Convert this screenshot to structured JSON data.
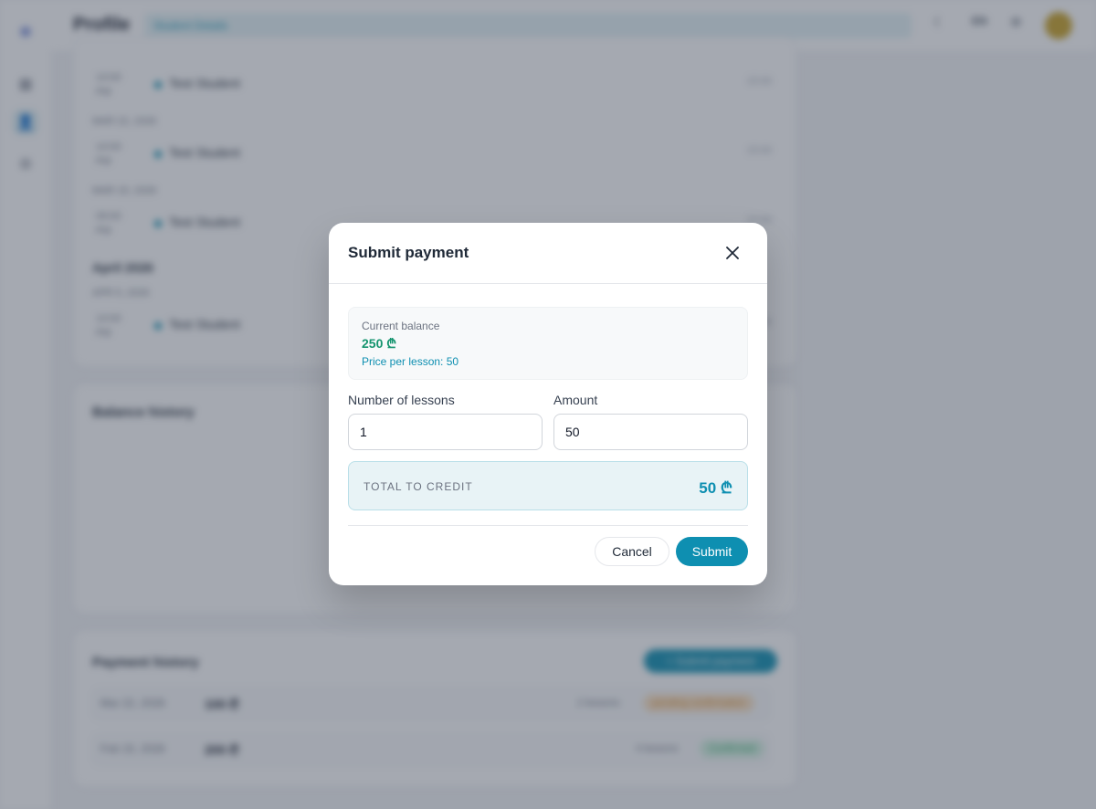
{
  "colors": {
    "accent": "#0e8fb1",
    "balance_green": "#14946e",
    "pending": "#f0a64a",
    "confirmed": "#34c37a"
  },
  "header": {
    "title": "Profile",
    "badge": "Student Details",
    "lang": "EN",
    "icons": [
      "moon-icon",
      "settings-icon",
      "avatar"
    ]
  },
  "sidebar": {
    "items": [
      "logo-icon",
      "calendar-icon",
      "user-icon",
      "settings-icon"
    ],
    "active": "user-icon"
  },
  "schedule": {
    "lessons": [
      {
        "time": "14:00 PM",
        "student": "Test Student",
        "end": "15:00"
      },
      {
        "time": "14:00 PM",
        "student": "Test Student",
        "end": "15:00"
      },
      {
        "time": "09:00 PM",
        "student": "Test Student",
        "end": "10:00"
      },
      {
        "time": "14:00 PM",
        "student": "Test Student",
        "end": "15:00"
      }
    ],
    "dates": [
      "MAR 22, 2026",
      "MAR 15, 2026",
      "APR 5, 2026"
    ],
    "month": "April 2026"
  },
  "balance_history": {
    "title": "Balance history"
  },
  "payment_history": {
    "title": "Payment history",
    "submit_button": "+ Submit payment",
    "rows": [
      {
        "date": "Mar 22, 2026",
        "amount": "100 ₾",
        "lessons": "2 lessons",
        "status": "pending confirmation"
      },
      {
        "date": "Feb 15, 2026",
        "amount": "200 ₾",
        "lessons": "4 lessons",
        "status": "Confirmed"
      }
    ]
  },
  "modal": {
    "title": "Submit payment",
    "close_icon": "close-icon",
    "balance_label": "Current balance",
    "balance_value": "250 ₾",
    "price_line": "Price per lesson: 50",
    "lessons_label": "Number of lessons",
    "lessons_value": "1",
    "amount_label": "Amount",
    "amount_value": "50",
    "total_label": "TOTAL TO CREDIT",
    "total_value": "50 ₾",
    "cancel_label": "Cancel",
    "submit_label": "Submit"
  }
}
